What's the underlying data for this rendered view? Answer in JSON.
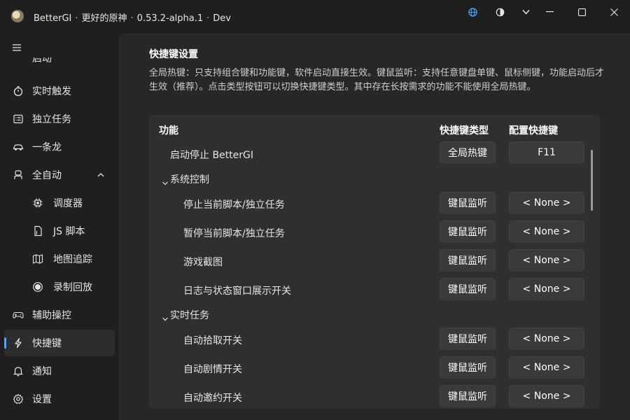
{
  "titlebar": {
    "app_name": "BetterGI",
    "subtitle": "更好的原神",
    "version": "0.53.2-alpha.1",
    "channel": "Dev",
    "sep": "·"
  },
  "sidebar": {
    "clipped_item": "启动",
    "items": [
      {
        "label": "实时触发",
        "icon": "stopwatch-icon"
      },
      {
        "label": "独立任务",
        "icon": "task-list-icon"
      },
      {
        "label": "一条龙",
        "icon": "car-icon"
      },
      {
        "label": "全自动",
        "icon": "bot-icon"
      },
      {
        "label": "调度器",
        "icon": "chip-icon"
      },
      {
        "label": "JS 脚本",
        "icon": "js-file-icon"
      },
      {
        "label": "地图追踪",
        "icon": "map-icon"
      },
      {
        "label": "录制回放",
        "icon": "record-icon"
      },
      {
        "label": "辅助操控",
        "icon": "gamepad-icon"
      },
      {
        "label": "快捷键",
        "icon": "lightning-icon"
      },
      {
        "label": "通知",
        "icon": "bell-icon"
      },
      {
        "label": "设置",
        "icon": "gear-icon"
      }
    ],
    "active": "快捷键"
  },
  "content": {
    "title": "快捷键设置",
    "description": "全局热键：只支持组合键和功能键，软件启动直接生效。键鼠监听：支持任意键盘单键、鼠标侧键，功能启动后才生效（推荐）。点击类型按钮可以切换快捷键类型。其中存在长按需求的功能不能使用全局热键。",
    "columns": {
      "function": "功能",
      "type": "快捷键类型",
      "key": "配置快捷键"
    },
    "top_row": {
      "label": "启动停止 BetterGI",
      "type": "全局热键",
      "key": "F11"
    },
    "groups": [
      {
        "name": "系统控制",
        "rows": [
          {
            "label": "停止当前脚本/独立任务",
            "type": "键鼠监听",
            "key": "< None >"
          },
          {
            "label": "暂停当前脚本/独立任务",
            "type": "键鼠监听",
            "key": "< None >"
          },
          {
            "label": "游戏截图",
            "type": "键鼠监听",
            "key": "< None >"
          },
          {
            "label": "日志与状态窗口展示开关",
            "type": "键鼠监听",
            "key": "< None >"
          }
        ]
      },
      {
        "name": "实时任务",
        "rows": [
          {
            "label": "自动拾取开关",
            "type": "键鼠监听",
            "key": "< None >"
          },
          {
            "label": "自动剧情开关",
            "type": "键鼠监听",
            "key": "< None >"
          },
          {
            "label": "自动邀约开关",
            "type": "键鼠监听",
            "key": "< None >"
          }
        ]
      }
    ]
  },
  "colors": {
    "accent": "#4aa8ff",
    "background": "#1f1f1f",
    "panel": "#272727",
    "card": "#2f2f2f",
    "button": "#3a3a3a"
  }
}
